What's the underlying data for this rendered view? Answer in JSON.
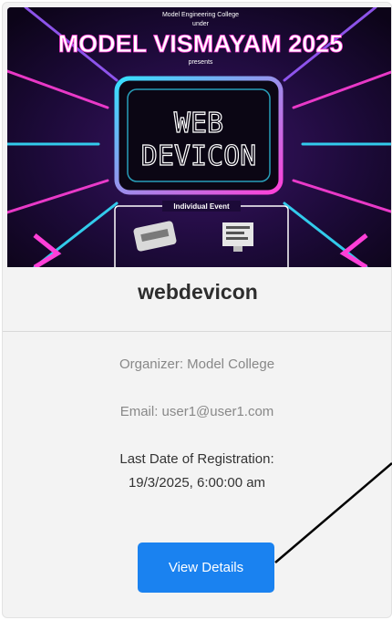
{
  "poster": {
    "top_text": "Model Engineering College",
    "sub_text": "under",
    "headline": "MODEL VISMAYAM 2025",
    "presents": "presents",
    "screen_line1": "WEB",
    "screen_line2": "DEVICON",
    "event_type": "Individual Event"
  },
  "card": {
    "title": "webdevicon",
    "organizer": "Organizer: Model College",
    "email": "Email: user1@user1.com",
    "deadline_label": "Last Date of Registration:",
    "deadline_value": "19/3/2025, 6:00:00 am",
    "button_label": "View Details"
  },
  "colors": {
    "accent": "#1a82f0",
    "neon_pink": "#ff3fd8",
    "neon_cyan": "#35e0ff"
  }
}
